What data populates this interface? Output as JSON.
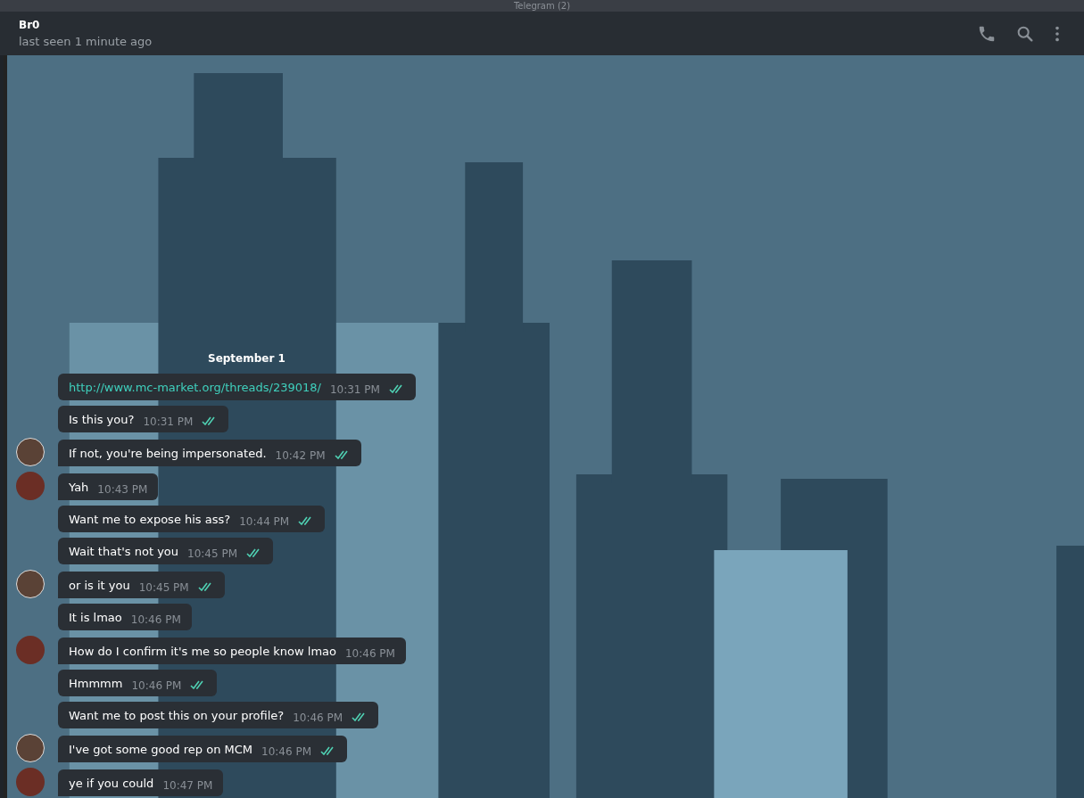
{
  "window": {
    "title": "Telegram (2)"
  },
  "header": {
    "name": "Br0",
    "status": "last seen 1 minute ago"
  },
  "date_label": "September 1",
  "messages": [
    {
      "kind": "link",
      "text": "http://www.mc-market.org/threads/239018/",
      "time": "10:31 PM",
      "read": true
    },
    {
      "kind": "text",
      "text": "Is this you?",
      "time": "10:31 PM",
      "read": true
    },
    {
      "kind": "text",
      "text": "If not, you're being impersonated.",
      "time": "10:42 PM",
      "read": true,
      "avatar": {
        "kind": "drink"
      }
    },
    {
      "kind": "text",
      "text": "Yah",
      "time": "10:43 PM",
      "read": false,
      "avatar": {
        "kind": "person"
      }
    },
    {
      "kind": "text",
      "text": "Want me to expose his ass?",
      "time": "10:44 PM",
      "read": true
    },
    {
      "kind": "text",
      "text": "Wait that's not you",
      "time": "10:45 PM",
      "read": true
    },
    {
      "kind": "text",
      "text": "or is it you",
      "time": "10:45 PM",
      "read": true,
      "avatar": {
        "kind": "drink"
      }
    },
    {
      "kind": "text",
      "text": "It is lmao",
      "time": "10:46 PM",
      "read": false
    },
    {
      "kind": "text",
      "text": "How do I confirm it's me so people know lmao",
      "time": "10:46 PM",
      "read": false,
      "avatar": {
        "kind": "person"
      }
    },
    {
      "kind": "text",
      "text": "Hmmmm",
      "time": "10:46 PM",
      "read": true
    },
    {
      "kind": "text",
      "text": "Want me to post this on your profile?",
      "time": "10:46 PM",
      "read": true
    },
    {
      "kind": "text",
      "text": "I've got some good rep on MCM",
      "time": "10:46 PM",
      "read": true,
      "avatar": {
        "kind": "drink"
      }
    },
    {
      "kind": "text",
      "text": "ye if you could",
      "time": "10:47 PM",
      "read": false,
      "avatar": {
        "kind": "person"
      }
    }
  ]
}
